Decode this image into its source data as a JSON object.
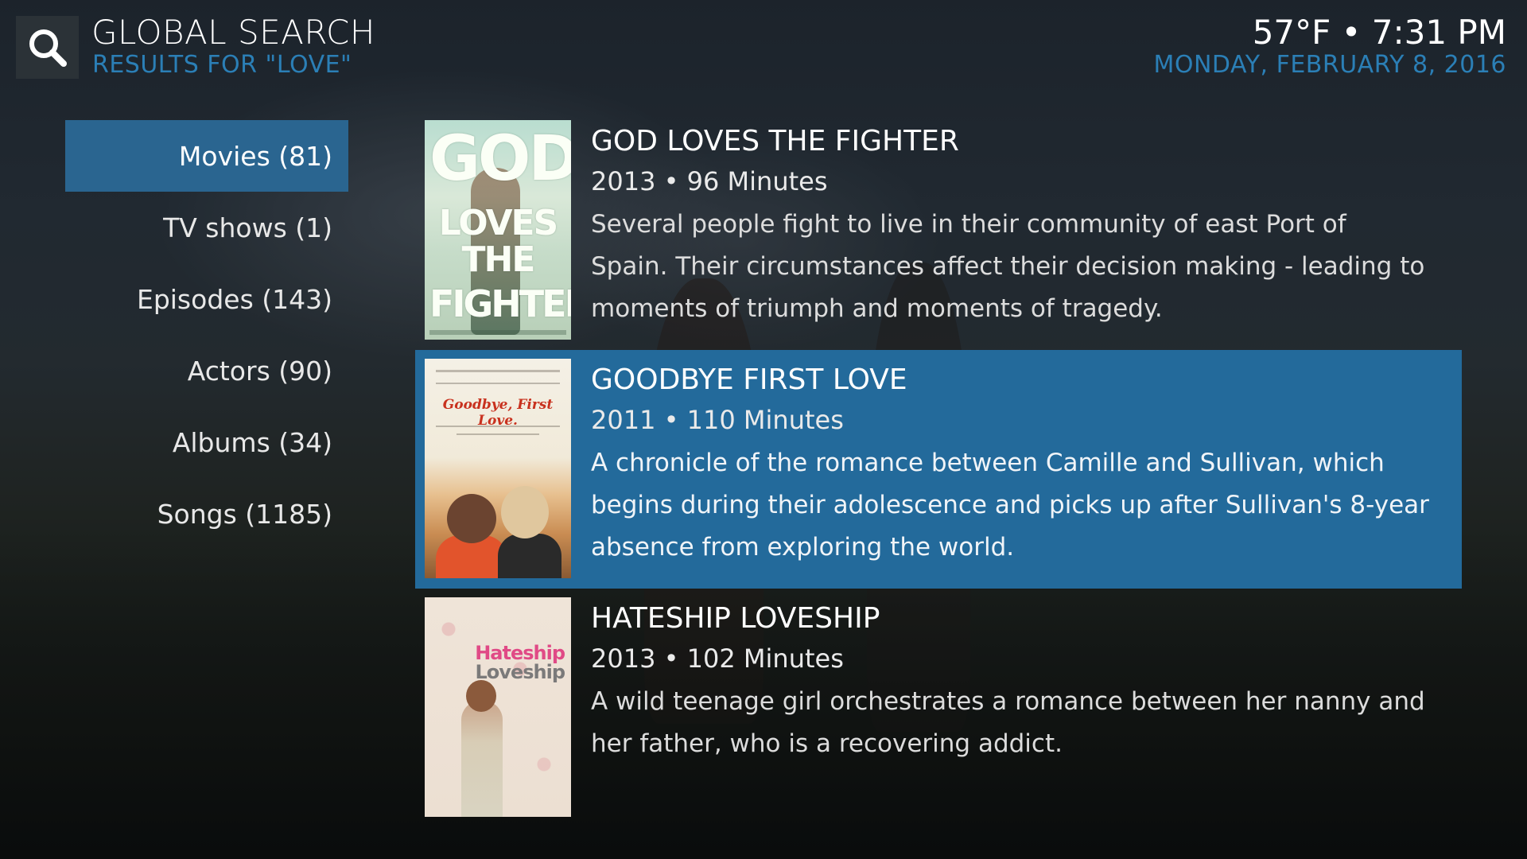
{
  "header": {
    "icon": "search-icon",
    "title": "GLOBAL SEARCH",
    "subtitle": "RESULTS FOR \"LOVE\"",
    "clock": "57°F • 7:31 PM",
    "date": "MONDAY, FEBRUARY 8, 2016"
  },
  "categories": [
    {
      "label": "Movies (81)",
      "selected": true
    },
    {
      "label": "TV shows (1)",
      "selected": false
    },
    {
      "label": "Episodes (143)",
      "selected": false
    },
    {
      "label": "Actors (90)",
      "selected": false
    },
    {
      "label": "Albums (34)",
      "selected": false
    },
    {
      "label": "Songs (1185)",
      "selected": false
    }
  ],
  "results": [
    {
      "title": "GOD LOVES THE FIGHTER",
      "meta": "2013 • 96 Minutes",
      "plot": "Several people fight to live in their community of east Port of Spain. Their circumstances affect their decision making - leading to moments of triumph and moments of tragedy.",
      "poster": {
        "text_lines": [
          "GOD",
          "LOVES",
          "THE",
          "FIGHTER"
        ]
      },
      "selected": false
    },
    {
      "title": "GOODBYE FIRST LOVE",
      "meta": "2011 • 110 Minutes",
      "plot": "A chronicle of the romance between Camille and Sullivan, which begins during their adolescence and picks up after Sullivan's 8-year absence from exploring the world.",
      "poster": {
        "text": "Goodbye, First Love."
      },
      "selected": true
    },
    {
      "title": "HATESHIP LOVESHIP",
      "meta": "2013 • 102 Minutes",
      "plot": "A wild teenage girl orchestrates a romance between her nanny and her father, who is a recovering addict.",
      "poster": {
        "text_lines": [
          "Hateship",
          "Loveship"
        ]
      },
      "selected": false
    }
  ],
  "colors": {
    "accent": "#2b7fb6",
    "selection": "#236a9b",
    "category_selection": "#2a6590"
  }
}
